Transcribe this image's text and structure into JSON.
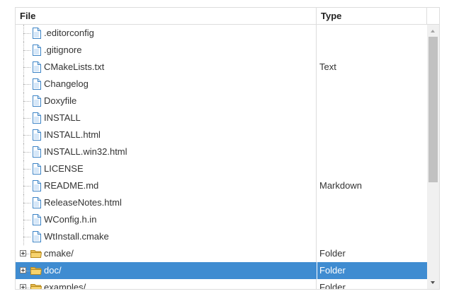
{
  "columns": {
    "file": "File",
    "type": "Type"
  },
  "rows": [
    {
      "name": ".editorconfig",
      "type": "",
      "kind": "file"
    },
    {
      "name": ".gitignore",
      "type": "",
      "kind": "file"
    },
    {
      "name": "CMakeLists.txt",
      "type": "Text",
      "kind": "file"
    },
    {
      "name": "Changelog",
      "type": "",
      "kind": "file"
    },
    {
      "name": "Doxyfile",
      "type": "",
      "kind": "file"
    },
    {
      "name": "INSTALL",
      "type": "",
      "kind": "file"
    },
    {
      "name": "INSTALL.html",
      "type": "",
      "kind": "file"
    },
    {
      "name": "INSTALL.win32.html",
      "type": "",
      "kind": "file"
    },
    {
      "name": "LICENSE",
      "type": "",
      "kind": "file"
    },
    {
      "name": "README.md",
      "type": "Markdown",
      "kind": "file"
    },
    {
      "name": "ReleaseNotes.html",
      "type": "",
      "kind": "file"
    },
    {
      "name": "WConfig.h.in",
      "type": "",
      "kind": "file"
    },
    {
      "name": "WtInstall.cmake",
      "type": "",
      "kind": "file"
    },
    {
      "name": "cmake/",
      "type": "Folder",
      "kind": "folder"
    },
    {
      "name": "doc/",
      "type": "Folder",
      "kind": "folder",
      "selected": true
    },
    {
      "name": "examples/",
      "type": "Folder",
      "kind": "folder"
    }
  ],
  "icons": {
    "file": "document-icon",
    "folder": "folder-icon",
    "expander": "expand-plus-icon"
  },
  "colors": {
    "selection": "#3f8cd1",
    "border": "#dddddd",
    "scroll_thumb": "#c1c1c1"
  }
}
